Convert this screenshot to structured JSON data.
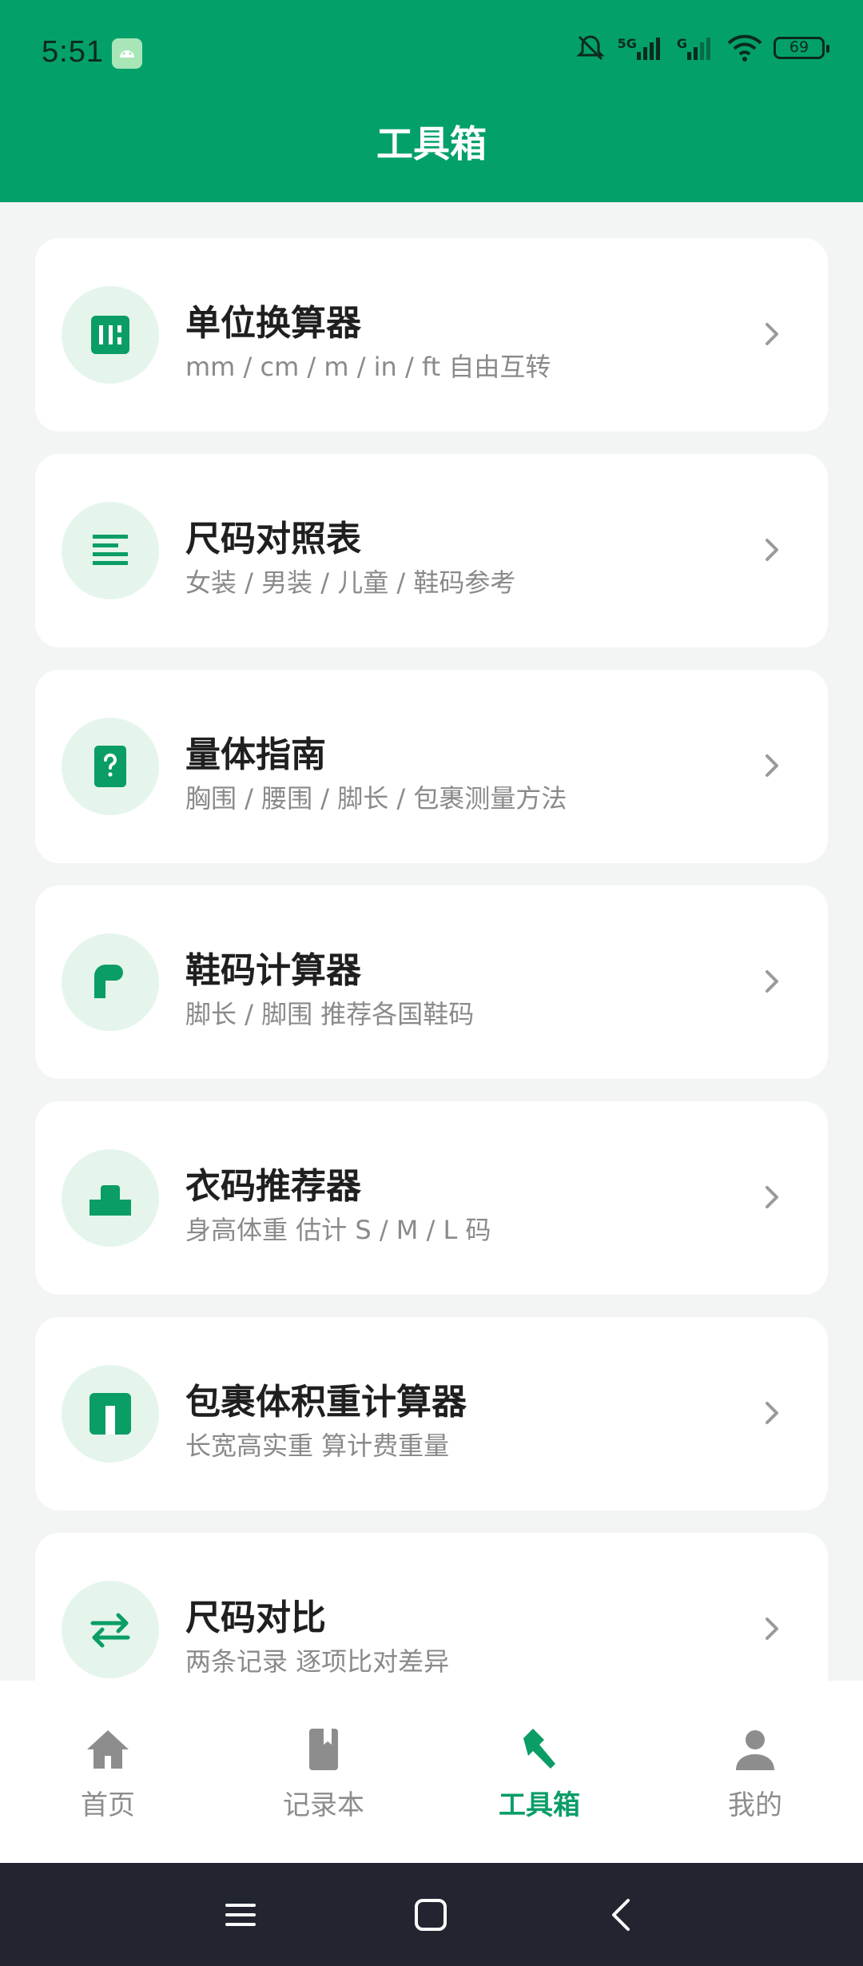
{
  "status_bar": {
    "time": "5:51",
    "network": "5G",
    "network2": "G",
    "battery": "69"
  },
  "header": {
    "title": "工具箱"
  },
  "tools": [
    {
      "title": "单位换算器",
      "subtitle": "mm / cm / m / in / ft 自由互转",
      "icon": "ruler-icon"
    },
    {
      "title": "尺码对照表",
      "subtitle": "女装 / 男装 / 儿童 / 鞋码参考",
      "icon": "list-icon"
    },
    {
      "title": "量体指南",
      "subtitle": "胸围 / 腰围 / 脚长 / 包裹测量方法",
      "icon": "help-book-icon"
    },
    {
      "title": "鞋码计算器",
      "subtitle": "脚长 / 脚围 推荐各国鞋码",
      "icon": "shoe-icon"
    },
    {
      "title": "衣码推荐器",
      "subtitle": "身高体重 估计 S / M / L 码",
      "icon": "body-icon"
    },
    {
      "title": "包裹体积重计算器",
      "subtitle": "长宽高实重 算计费重量",
      "icon": "package-icon"
    },
    {
      "title": "尺码对比",
      "subtitle": "两条记录 逐项比对差异",
      "icon": "compare-icon"
    }
  ],
  "bottom_nav": [
    {
      "label": "首页",
      "icon": "home-icon",
      "active": false
    },
    {
      "label": "记录本",
      "icon": "notebook-icon",
      "active": false
    },
    {
      "label": "工具箱",
      "icon": "toolbox-icon",
      "active": true
    },
    {
      "label": "我的",
      "icon": "person-icon",
      "active": false
    }
  ],
  "colors": {
    "accent": "#04a06a",
    "icon_bg": "#e5f5ec",
    "icon": "#0a9d66"
  }
}
